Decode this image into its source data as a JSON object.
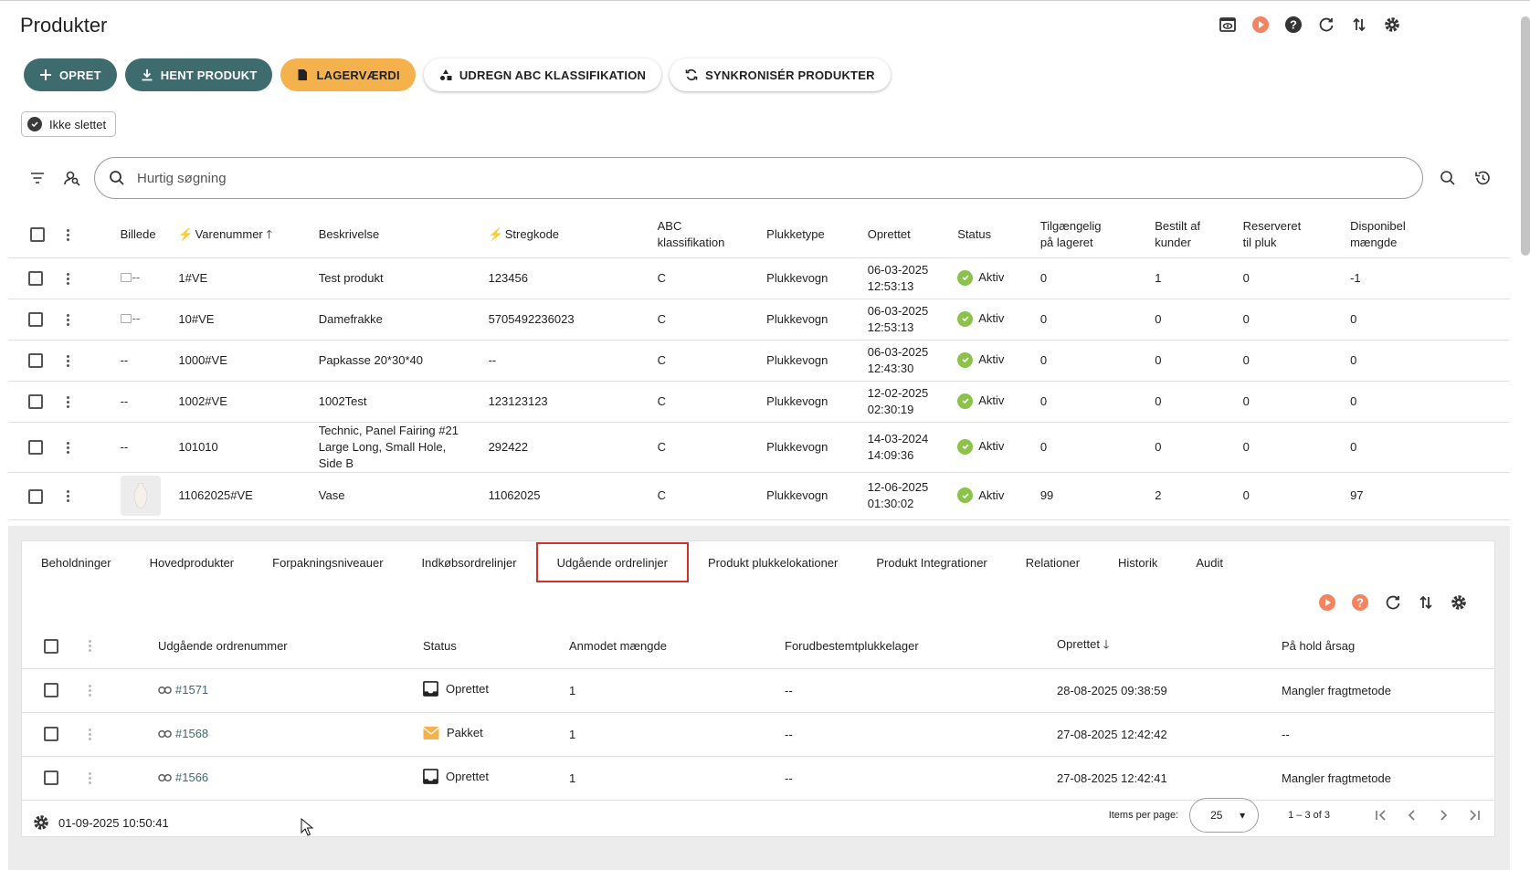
{
  "page": {
    "title": "Produkter"
  },
  "toolbar": {
    "opret": "OPRET",
    "hent_produkt": "HENT PRODUKT",
    "lagervaerdi": "LAGERVÆRDI",
    "udregn_abc": "UDREGN ABC KLASSIFIKATION",
    "synkroniser": "SYNKRONISÉR PRODUKTER"
  },
  "filter_chip": {
    "label": "Ikke slettet"
  },
  "search": {
    "placeholder": "Hurtig søgning"
  },
  "columns": {
    "billede": "Billede",
    "varenummer": "Varenummer",
    "beskrivelse": "Beskrivelse",
    "stregkode": "Stregkode",
    "abc_1": "ABC",
    "abc_2": "klassifikation",
    "plukketype": "Plukketype",
    "oprettet": "Oprettet",
    "status": "Status",
    "tilg_1": "Tilgængelig",
    "tilg_2": "på lageret",
    "bestilt_1": "Bestilt af",
    "bestilt_2": "kunder",
    "reserveret_1": "Reserveret",
    "reserveret_2": "til pluk",
    "disp_1": "Disponibel",
    "disp_2": "mængde"
  },
  "products": [
    {
      "billede": "--",
      "varenummer": "1#VE",
      "beskrivelse_1": "Test produkt",
      "beskrivelse_2": "",
      "beskrivelse_3": "",
      "stregkode": "123456",
      "abc": "C",
      "plukketype": "Plukkevogn",
      "oprettet_date": "06-03-2025",
      "oprettet_time": "12:53:13",
      "status": "Aktiv",
      "tilgaengelig": "0",
      "bestilt": "1",
      "reserveret": "0",
      "disponibel": "-1"
    },
    {
      "billede": "--",
      "varenummer": "10#VE",
      "beskrivelse_1": "Damefrakke",
      "beskrivelse_2": "",
      "beskrivelse_3": "",
      "stregkode": "5705492236023",
      "abc": "C",
      "plukketype": "Plukkevogn",
      "oprettet_date": "06-03-2025",
      "oprettet_time": "12:53:13",
      "status": "Aktiv",
      "tilgaengelig": "0",
      "bestilt": "0",
      "reserveret": "0",
      "disponibel": "0"
    },
    {
      "billede": "--",
      "varenummer": "1000#VE",
      "beskrivelse_1": "Papkasse 20*30*40",
      "beskrivelse_2": "",
      "beskrivelse_3": "",
      "stregkode": "--",
      "abc": "C",
      "plukketype": "Plukkevogn",
      "oprettet_date": "06-03-2025",
      "oprettet_time": "12:43:30",
      "status": "Aktiv",
      "tilgaengelig": "0",
      "bestilt": "0",
      "reserveret": "0",
      "disponibel": "0"
    },
    {
      "billede": "--",
      "varenummer": "1002#VE",
      "beskrivelse_1": "1002Test",
      "beskrivelse_2": "",
      "beskrivelse_3": "",
      "stregkode": "123123123",
      "abc": "C",
      "plukketype": "Plukkevogn",
      "oprettet_date": "12-02-2025",
      "oprettet_time": "02:30:19",
      "status": "Aktiv",
      "tilgaengelig": "0",
      "bestilt": "0",
      "reserveret": "0",
      "disponibel": "0"
    },
    {
      "billede": "--",
      "varenummer": "101010",
      "beskrivelse_1": "Technic, Panel Fairing #21",
      "beskrivelse_2": "Large Long, Small Hole,",
      "beskrivelse_3": "Side B",
      "stregkode": "292422",
      "abc": "C",
      "plukketype": "Plukkevogn",
      "oprettet_date": "14-03-2024",
      "oprettet_time": "14:09:36",
      "status": "Aktiv",
      "tilgaengelig": "0",
      "bestilt": "0",
      "reserveret": "0",
      "disponibel": "0"
    },
    {
      "billede": "",
      "varenummer": "11062025#VE",
      "beskrivelse_1": "Vase",
      "beskrivelse_2": "",
      "beskrivelse_3": "",
      "stregkode": "11062025",
      "abc": "C",
      "plukketype": "Plukkevogn",
      "oprettet_date": "12-06-2025",
      "oprettet_time": "01:30:02",
      "status": "Aktiv",
      "tilgaengelig": "99",
      "bestilt": "2",
      "reserveret": "0",
      "disponibel": "97"
    }
  ],
  "tabs": [
    {
      "label": "Beholdninger"
    },
    {
      "label": "Hovedprodukter"
    },
    {
      "label": "Forpakningsniveauer"
    },
    {
      "label": "Indkøbsordrelinjer"
    },
    {
      "label": "Udgående ordrelinjer",
      "active": true
    },
    {
      "label": "Produkt plukkelokationer"
    },
    {
      "label": "Produkt Integrationer"
    },
    {
      "label": "Relationer"
    },
    {
      "label": "Historik"
    },
    {
      "label": "Audit"
    }
  ],
  "sub_columns": {
    "ordrenummer": "Udgående ordrenummer",
    "status": "Status",
    "anmodet": "Anmodet mængde",
    "forudbestemt": "Forudbestemtplukkelager",
    "oprettet": "Oprettet",
    "paa_hold": "På hold årsag"
  },
  "order_lines": [
    {
      "ordrenummer": "#1571",
      "status": "Oprettet",
      "status_icon": "inbox-icon",
      "anmodet": "1",
      "forudbestemt": "--",
      "oprettet": "28-08-2025 09:38:59",
      "paa_hold": "Mangler fragtmetode"
    },
    {
      "ordrenummer": "#1568",
      "status": "Pakket",
      "status_icon": "envelope-icon",
      "anmodet": "1",
      "forudbestemt": "--",
      "oprettet": "27-08-2025 12:42:42",
      "paa_hold": "--"
    },
    {
      "ordrenummer": "#1566",
      "status": "Oprettet",
      "status_icon": "inbox-icon",
      "anmodet": "1",
      "forudbestemt": "--",
      "oprettet": "27-08-2025 12:42:41",
      "paa_hold": "Mangler fragtmetode"
    }
  ],
  "footer": {
    "timestamp": "01-09-2025 10:50:41",
    "items_per_page_label": "Items per page:",
    "items_per_page": "25",
    "range": "1 – 3 of 3"
  },
  "colors": {
    "accent": "#3d6b6e",
    "orange": "#f5b14c",
    "active_tab_border": "#d32f2f",
    "status_ok": "#8bc34a"
  }
}
